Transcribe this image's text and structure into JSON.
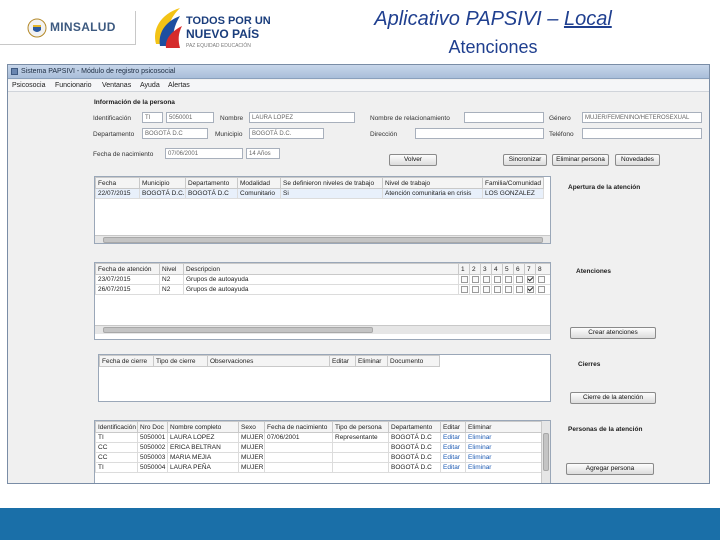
{
  "header": {
    "ministry_logo_text": "MINSALUD",
    "slogan_logo_line1": "TODOS POR UN",
    "slogan_logo_line2": "NUEVO PAÍS",
    "slogan_logo_line3": "PAZ EQUIDAD EDUCACIÓN",
    "title_prefix": "Aplicativo PAPSIVI – ",
    "title_underlined": "Local",
    "subtitle": "Atenciones"
  },
  "window": {
    "title": "Sistema PAPSIVI - Módulo de registro psicosocial",
    "menu": [
      "Psicosocia",
      "Funcionario",
      "Ventanas",
      "Ayuda",
      "Alertas"
    ]
  },
  "person": {
    "section_title": "Información de la persona",
    "fields": {
      "identificacion_label": "Identificación",
      "identificacion_type": "TI",
      "identificacion_number": "5050001",
      "nombre_label": "Nombre",
      "nombre_value": "LAURA LOPEZ",
      "relacionamiento_label": "Nombre de relacionamiento",
      "relacionamiento_value": "",
      "genero_label": "Género",
      "genero_value": "MUJER/FEMENINO/HETEROSEXUAL",
      "departamento_label": "Departamento",
      "departamento_value": "BOGOTÁ D.C",
      "municipio_label": "Municipio",
      "municipio_value": "BOGOTÁ D.C.",
      "direccion_label": "Dirección",
      "direccion_value": "",
      "telefono_label": "Teléfono",
      "telefono_value": "",
      "nacimiento_label": "Fecha de nacimiento",
      "nacimiento_value": "07/06/2001",
      "edad_value": "14 Años"
    },
    "buttons": {
      "volver": "Volver",
      "sincronizar": "Sincronizar",
      "eliminar": "Eliminar persona",
      "novedades": "Novedades"
    }
  },
  "apertura": {
    "side_title": "Apertura de la atención",
    "columns": [
      "Fecha",
      "Municipio",
      "Departamento",
      "Modalidad",
      "Se definieron niveles de trabajo",
      "Nivel de trabajo",
      "Familia/Comunidad"
    ],
    "rows": [
      [
        "22/07/2015",
        "BOGOTÁ D.C.",
        "BOGOTÁ D.C",
        "Comunitario",
        "Si",
        "Atención comunitaria en crisis",
        "LOS GONZALEZ"
      ]
    ]
  },
  "atenciones": {
    "side_title": "Atenciones",
    "columns": [
      "Fecha de atención",
      "Nivel",
      "Descripcion"
    ],
    "number_columns": [
      "1",
      "2",
      "3",
      "4",
      "5",
      "6",
      "7",
      "8"
    ],
    "rows": [
      {
        "cells": [
          "23/07/2015",
          "N2",
          "Grupos de autoayuda"
        ],
        "checked": [
          false,
          false,
          false,
          false,
          false,
          false,
          true,
          false
        ]
      },
      {
        "cells": [
          "26/07/2015",
          "N2",
          "Grupos de autoayuda"
        ],
        "checked": [
          false,
          false,
          false,
          false,
          false,
          false,
          true,
          false
        ]
      }
    ],
    "create_button": "Crear atenciones"
  },
  "cierres": {
    "side_title": "Cierres",
    "columns": [
      "Fecha de cierre",
      "Tipo de cierre",
      "Observaciones",
      "Editar",
      "Eliminar",
      "Documento"
    ],
    "close_button": "Cierre de la atención"
  },
  "personas": {
    "side_title": "Personas de la atención",
    "columns": [
      "Identificación",
      "Nro Doc",
      "Nombre completo",
      "Sexo",
      "Fecha de nacimiento",
      "Tipo de persona",
      "Departamento",
      "Editar",
      "Eliminar"
    ],
    "rows": [
      [
        "TI",
        "5050001",
        "LAURA LOPEZ",
        "MUJER",
        "07/06/2001",
        "Representante",
        "BOGOTÁ D.C",
        "Editar",
        "Eliminar"
      ],
      [
        "CC",
        "5050002",
        "ERICA BELTRAN",
        "MUJER",
        "",
        "",
        "BOGOTÁ D.C",
        "Editar",
        "Eliminar"
      ],
      [
        "CC",
        "5050003",
        "MARIA MEJIA",
        "MUJER",
        "",
        "",
        "BOGOTÁ D.C",
        "Editar",
        "Eliminar"
      ],
      [
        "TI",
        "5050004",
        "LAURA PEÑA",
        "MUJER",
        "",
        "",
        "BOGOTÁ D.C",
        "Editar",
        "Eliminar"
      ]
    ],
    "add_button": "Agregar persona"
  },
  "colors": {
    "title_blue": "#1f3f8f",
    "bottom_bar": "#1a6fa8",
    "link_blue": "#1e5bb4"
  }
}
